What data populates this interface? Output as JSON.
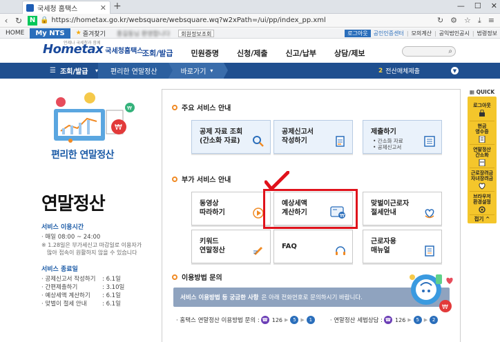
{
  "browser": {
    "tab_title": "국세청 홈택스",
    "url": "https://hometax.go.kr/websquare/websquare.wq?w2xPath=/ui/pp/index_pp.xml"
  },
  "topbar": {
    "home": "HOME",
    "my_nts": "My NTS",
    "favorites": "즐겨찾기",
    "user_name": "홍길동님 환영합니다",
    "member_info": "회원정보조회",
    "logout": "로그아웃",
    "cert_center": "공인인증센터",
    "mock_calc": "모의계산",
    "public_notice": "공익법인공시",
    "law_info": "법령정보"
  },
  "header": {
    "logo_main": "Hometax",
    "logo_sub": "국세청홈택스",
    "logo_tag": "언제나 국세청과 함께",
    "nav": [
      "조회/발급",
      "민원증명",
      "신청/제출",
      "신고/납부",
      "상담/제보"
    ]
  },
  "locbar": {
    "menu": "조회/발급",
    "crumb1": "편리한 연말정산",
    "crumb2": "바로가기",
    "batch_num": "2",
    "batch_label": "전산매체제출"
  },
  "left": {
    "illust_title": "편리한 연말정산",
    "heading": "연말정산",
    "hours_title": "서비스 이용시간",
    "hours_line1": "· 매일 08:00 ~ 24:00",
    "hours_note1": "※ 1.28일은 부가세신고 마감일로 이용자가",
    "hours_note2": "많아 접속이 원활하지 않을 수 있습니다",
    "end_title": "서비스 종료일",
    "end_items": [
      {
        "label": "· 공제신고서 작성하기",
        "value": ": 6.1일"
      },
      {
        "label": "· 간편제출하기",
        "value": ": 3.10일"
      },
      {
        "label": "· 예상세액 계산하기",
        "value": ": 6.1일"
      },
      {
        "label": "· 맞벌이 절세 안내",
        "value": ": 6.1일"
      }
    ]
  },
  "main": {
    "sec1": "주요 서비스 안내",
    "sec2": "부가 서비스 안내",
    "sec3": "이용방법 문의",
    "cards_main": [
      {
        "label": "공제 자료 조회\n(간소화 자료)",
        "sub": ""
      },
      {
        "label": "공제신고서\n작성하기",
        "sub": ""
      },
      {
        "label": "제출하기",
        "sub": "• 간소화 자료\n• 공제신고서"
      }
    ],
    "cards_extra": [
      {
        "label": "동영상\n따라하기"
      },
      {
        "label": "예상세액\n계산하기"
      },
      {
        "label": "맞벌이근로자\n절세안내"
      },
      {
        "label": "키워드\n연말정산"
      },
      {
        "label": "FAQ"
      },
      {
        "label": "근로자용\n매뉴얼"
      }
    ],
    "banner_bold": "서비스 이용방법 등 궁금한 사항",
    "banner_text": "은 아래 전화번호로 문의하시기 바랍니다.",
    "phone1_label": "· 홈택스 연말정산 이용방법 문의 :",
    "phone1_num": "126",
    "phone1_steps": [
      "5",
      "1"
    ],
    "phone2_label": "· 연말정산 세법상담 :",
    "phone2_num": "126",
    "phone2_steps": [
      "5",
      "2"
    ]
  },
  "quick": {
    "title": "QUICK",
    "items": [
      "로그아웃",
      "현금\n영수증",
      "연말정산\n간소화",
      "근로장려금\n자녀장려금",
      "브라우저\n환경설정"
    ],
    "close": "접기 ^"
  },
  "colors": {
    "brand": "#1a4a9c",
    "locbar": "#1f4f8f",
    "accent_orange": "#f08a24",
    "highlight_red": "#e0121b",
    "quick_yellow": "#f4c62b"
  }
}
